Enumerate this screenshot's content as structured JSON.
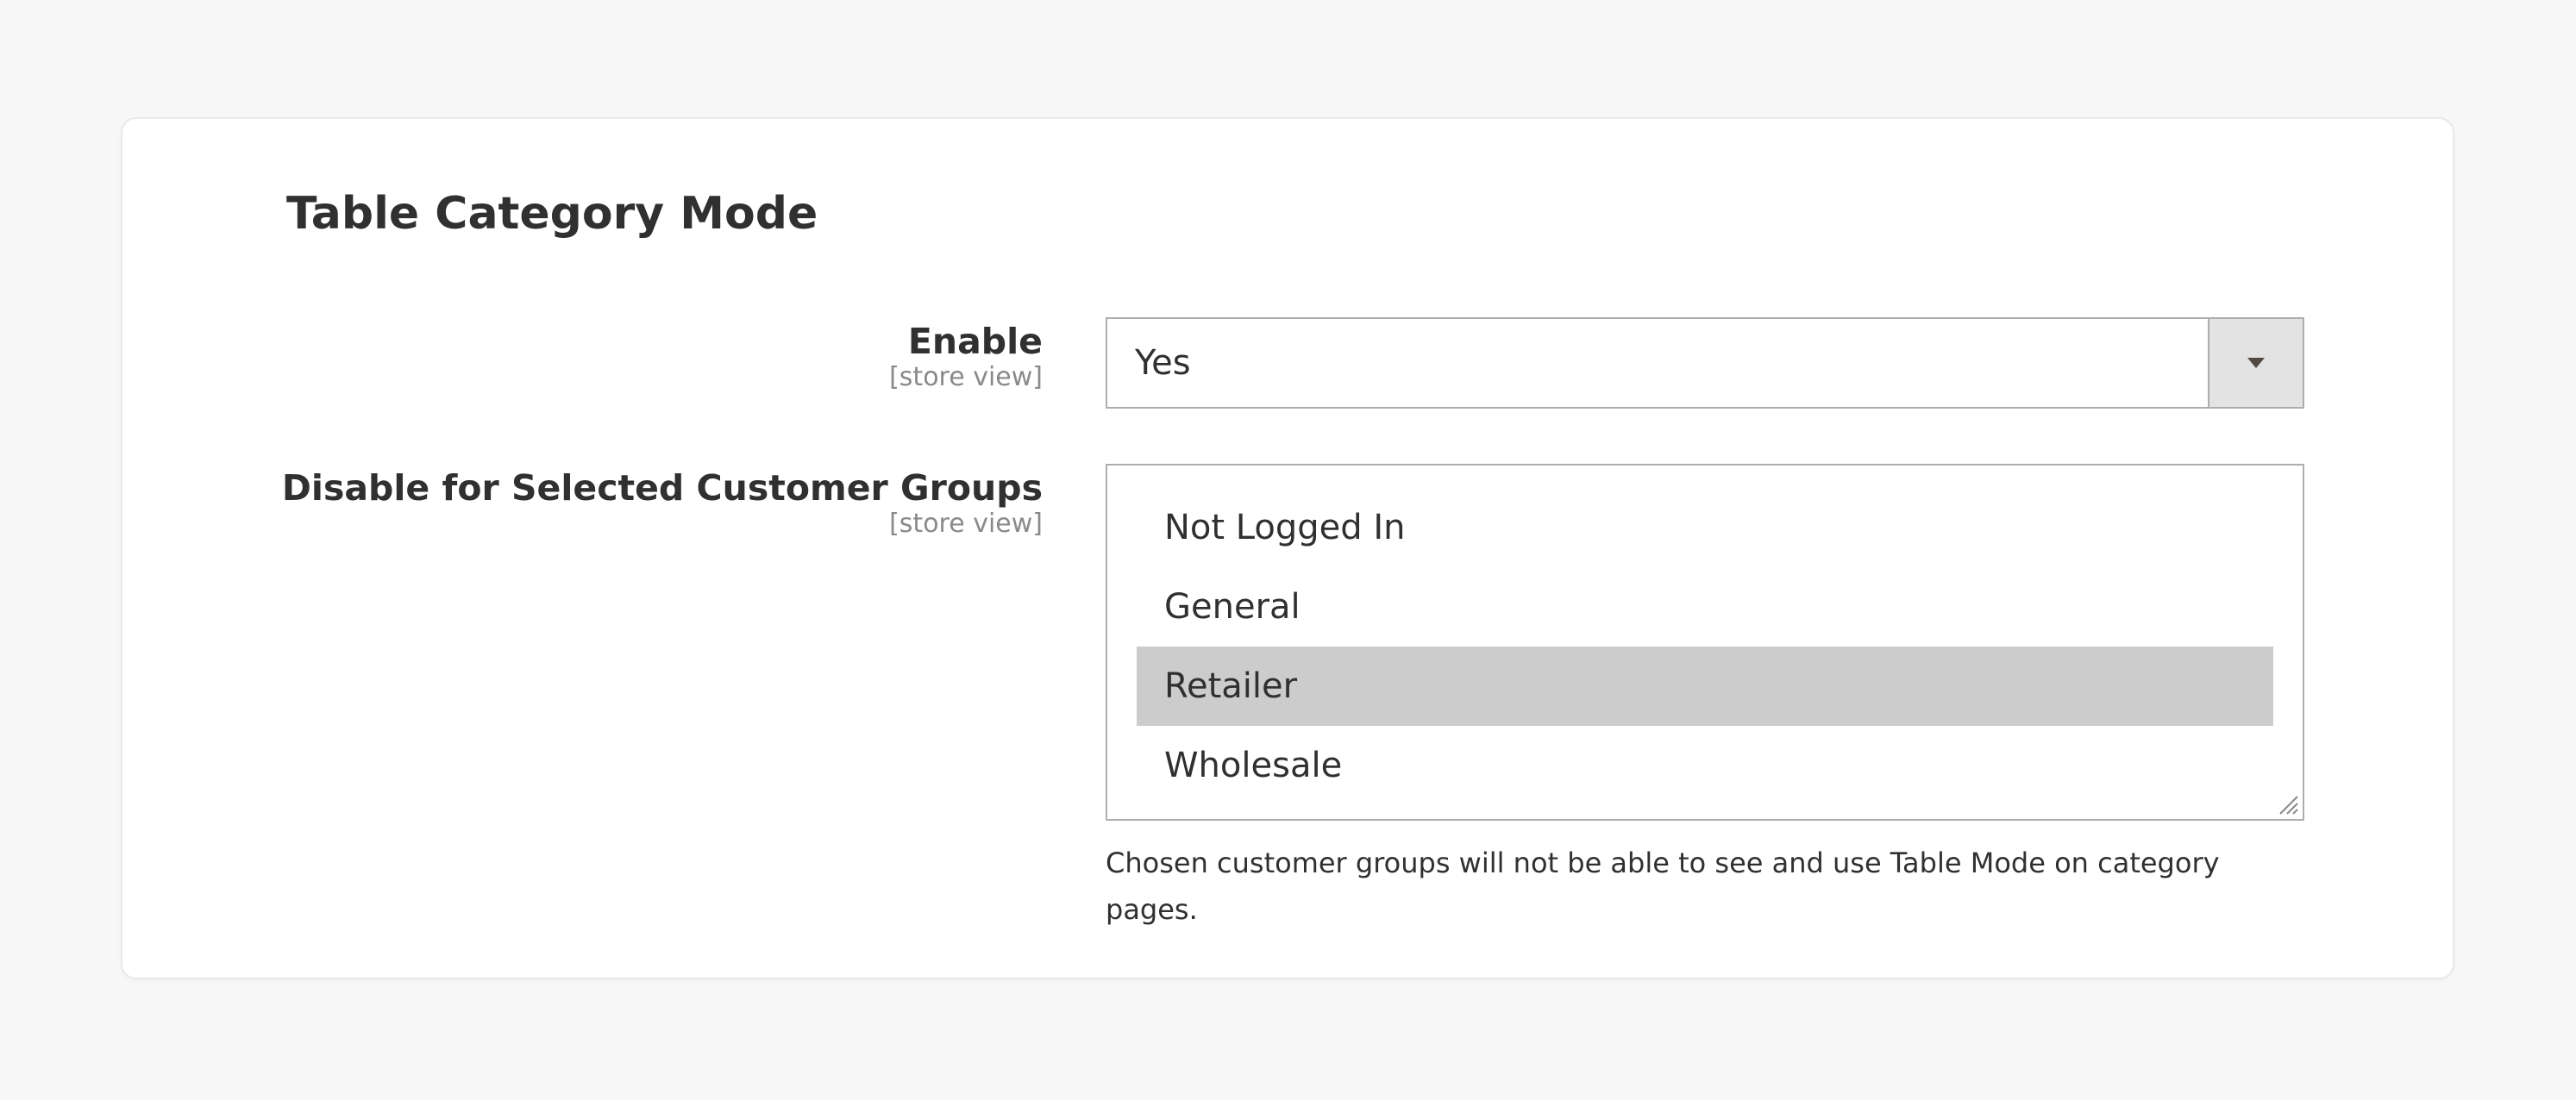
{
  "section": {
    "title": "Table Category Mode"
  },
  "fields": {
    "enable": {
      "label": "Enable",
      "scope": "[store view]",
      "value": "Yes"
    },
    "customer_groups": {
      "label": "Disable for Selected Customer Groups",
      "scope": "[store view]",
      "options": [
        "Not Logged In",
        "General",
        "Retailer",
        "Wholesale"
      ],
      "selected": "Retailer",
      "note": "Chosen customer groups will not be able to see and use Table Mode on category pages."
    }
  },
  "icons": {
    "dropdown": "chevron-down-icon",
    "resize": "resize-handle-icon"
  },
  "colors": {
    "selected_option_bg": "#cccccc",
    "border": "#adadad",
    "dropdown_button_bg": "#e3e3e3"
  }
}
